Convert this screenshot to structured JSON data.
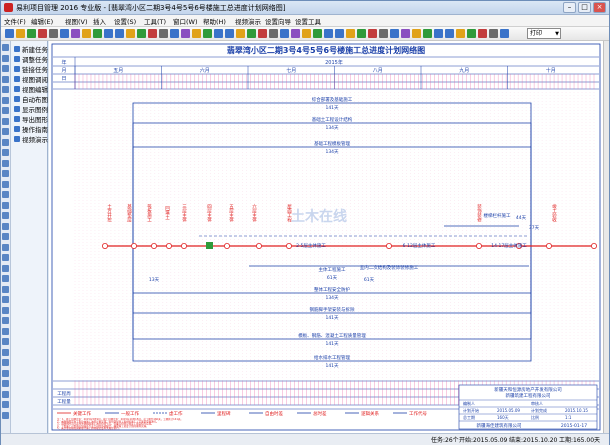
{
  "window": {
    "title": "易利项目管理 2016 专业版 - [翡翠湾小区二期3号4号5号6号楼施工总进度计划网络图]"
  },
  "menu": [
    "文件(F)",
    "编辑(E)",
    "视图(V)",
    "插入",
    "设置(S)",
    "工具(T)",
    "窗口(W)",
    "帮助(H)",
    "视频演示",
    "设置向导",
    "设置工具"
  ],
  "toolbar": {
    "view_select": "打印"
  },
  "sidebar": [
    "新建任务",
    "调整任务",
    "链接任务",
    "视图调阅",
    "视图编辑",
    "自动布图",
    "显示图例",
    "导出图形",
    "操作指南",
    "视频演示"
  ],
  "chart": {
    "title": "翡翠湾小区二期3号4号5号6号楼施工总进度计划网络图",
    "year": "2015年",
    "row_labels": {
      "year": "年",
      "month": "月",
      "day": "日",
      "engineering": "工程周",
      "volume": "工程量",
      "resource": "剩余工日"
    },
    "months": [
      "五月",
      "六月",
      "七月",
      "八月",
      "九月",
      "十月"
    ],
    "tasks": [
      {
        "name": "综合部署及基础施工",
        "days": "141天"
      },
      {
        "name": "基础土工程设计结构",
        "days": "134天"
      },
      {
        "name": "基础工程模板管理",
        "days": "134天"
      },
      {
        "name": "主体工程施工",
        "days": "61天"
      },
      {
        "name": "整体工程安全防护",
        "days": "134天"
      },
      {
        "name": "钢筋脚手架安装与拆除",
        "days": "141天"
      },
      {
        "name": "模板、钢筋、混凝土工程质量管理",
        "days": "141天"
      },
      {
        "name": "给水排水工程管理",
        "days": "141天"
      }
    ],
    "node_labels": [
      "土方开挖",
      "基础垫层",
      "筏板施工",
      "回填土",
      "三层主体",
      "四层主体",
      "五层主体",
      "六层主体",
      "屋面工程",
      "装饰装修",
      "竣工验收"
    ],
    "sub_labels": [
      "13天",
      "37天",
      "44天",
      "61天",
      "2-5层主体施工",
      "6-12层主体施工",
      "14-17层主体施工",
      "室内二次结构及装饰装修施工",
      "楼梯栏杆施工"
    ],
    "legend": [
      "关键工作",
      "一般工作",
      "虚工作",
      "里程碑",
      "自由时差",
      "总时差",
      "逻辑关系",
      "工作代号"
    ],
    "notes": [
      "注：1、开工日期定于：2015年5月9日，竣工日期定于：2015年10月15日，总工期为160天，工期共计141天。",
      "2、本图例所示为工程总体施工进度计划安排，各分部分项工程按照施工工艺要求穿插进行。",
      "3、该图例所示内容为关键线路施工进度控制节点，需重点控制以保证工期目标的实现。",
      "4、工程施工过程中应加强各专业之间的协调配合，确保施工进度计划的顺利实施。",
      "5、未尽事宜按照国家现行施工验收规范及有关规定执行。"
    ],
    "info": {
      "company": "新疆天和恒源房地产开发有限公司",
      "contractor": "新疆筑建工程有限公司",
      "rows": [
        [
          "编制人",
          "",
          "审核人",
          ""
        ],
        [
          "计划开始",
          "2015.05.09",
          "计划完成",
          "2015.10.15"
        ],
        [
          "总工期",
          "160天",
          "比例",
          "1:1"
        ]
      ],
      "footer": "新疆海佳建筑有限公司",
      "date": "2015-01-17"
    },
    "watermark": "土木在线"
  },
  "status": {
    "task": "任务:26个",
    "start": "开始:2015.05.09",
    "finish": "结束:2015.10.20",
    "duration": "工期:165.00天",
    "brand": "易利项目管理"
  }
}
